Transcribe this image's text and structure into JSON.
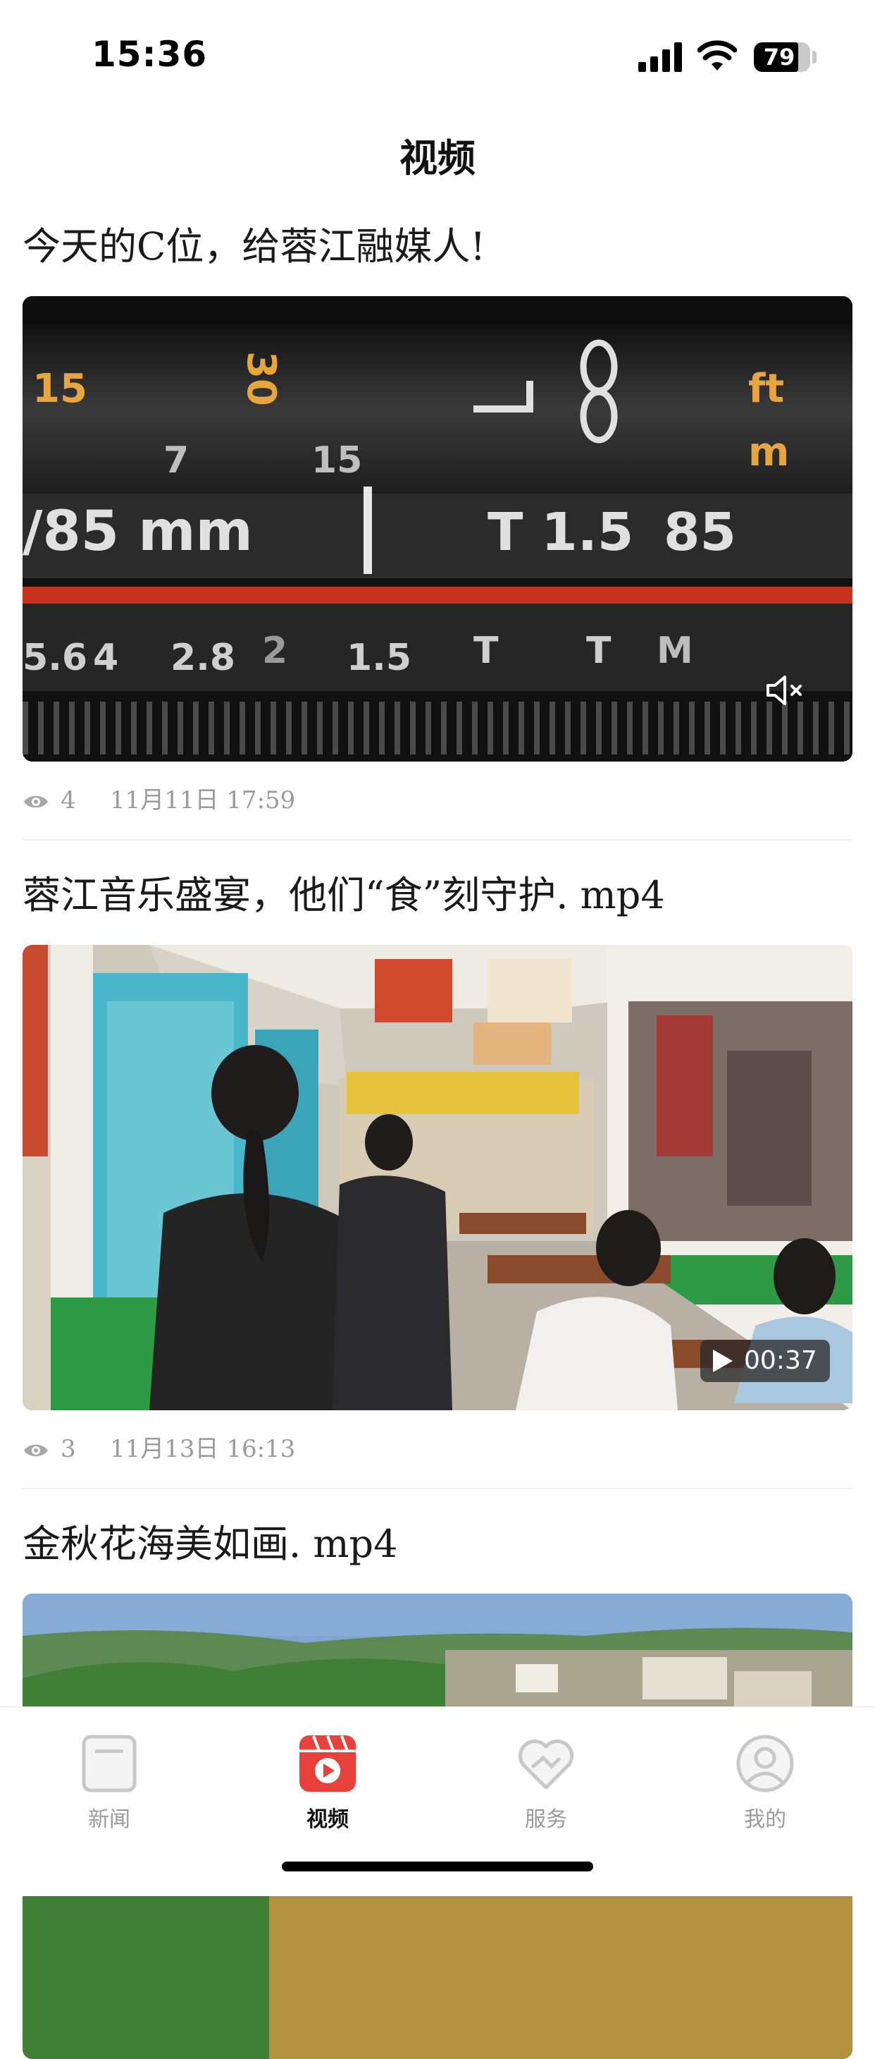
{
  "status_bar": {
    "time": "15:36",
    "battery": "79",
    "battery_level": 0.79
  },
  "header": {
    "title": "视频"
  },
  "posts": [
    {
      "title": "今天的C位，给蓉江融媒人!",
      "views": "4",
      "date": "11月11日 17:59",
      "lens_text": [
        "15",
        "30",
        "7",
        "15",
        "/85 mm",
        "T 1.5",
        "85",
        "ft",
        "m",
        "5.6",
        "4",
        "2.8",
        "2",
        "1.5",
        "T",
        "T",
        "M"
      ],
      "muted": true
    },
    {
      "title": "蓉江音乐盛宴，他们“食”刻守护. mp4",
      "views": "3",
      "date": "11月13日 16:13",
      "duration": "00:37"
    },
    {
      "title": "金秋花海美如画. mp4"
    }
  ],
  "tab_bar": {
    "tabs": [
      {
        "label": "新闻",
        "icon": "news-icon",
        "active": false
      },
      {
        "label": "视频",
        "icon": "video-icon",
        "active": true
      },
      {
        "label": "服务",
        "icon": "service-icon",
        "active": false
      },
      {
        "label": "我的",
        "icon": "profile-icon",
        "active": false
      }
    ],
    "accent": "#e8403a",
    "inactive_color": "#c8c8c8"
  }
}
